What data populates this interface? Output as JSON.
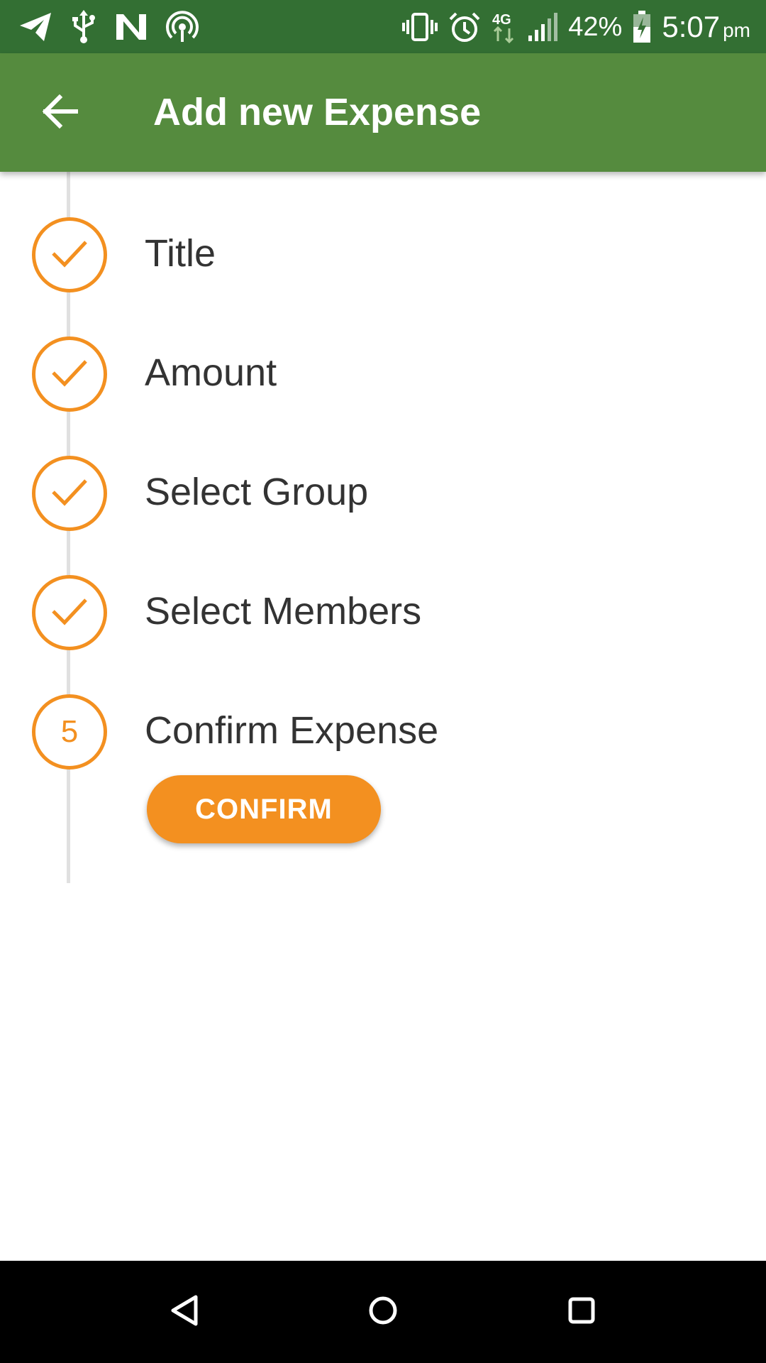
{
  "status_bar": {
    "battery_percent": "42%",
    "time": "5:07",
    "ampm": "pm",
    "left_icons": [
      "telegram-icon",
      "usb-icon",
      "n-app-icon",
      "hotspot-icon"
    ],
    "right_icons": [
      "vibrate-icon",
      "alarm-icon",
      "4g-icon",
      "signal-icon",
      "battery-charging-icon"
    ]
  },
  "app_bar": {
    "title": "Add new Expense",
    "back_icon": "arrow-back-icon"
  },
  "steps": [
    {
      "label": "Title",
      "state": "completed"
    },
    {
      "label": "Amount",
      "state": "completed"
    },
    {
      "label": "Select Group",
      "state": "completed"
    },
    {
      "label": "Select Members",
      "state": "completed"
    },
    {
      "label": "Confirm Expense",
      "state": "active",
      "number": "5"
    }
  ],
  "confirm_button": {
    "label": "CONFIRM"
  },
  "nav_bar": {
    "icons": [
      "back-triangle-icon",
      "home-circle-icon",
      "recents-square-icon"
    ]
  },
  "colors": {
    "status_bar": "#336f33",
    "app_bar": "#558b3e",
    "accent": "#f39020",
    "text": "#333333",
    "connector": "#e0e0e0"
  }
}
